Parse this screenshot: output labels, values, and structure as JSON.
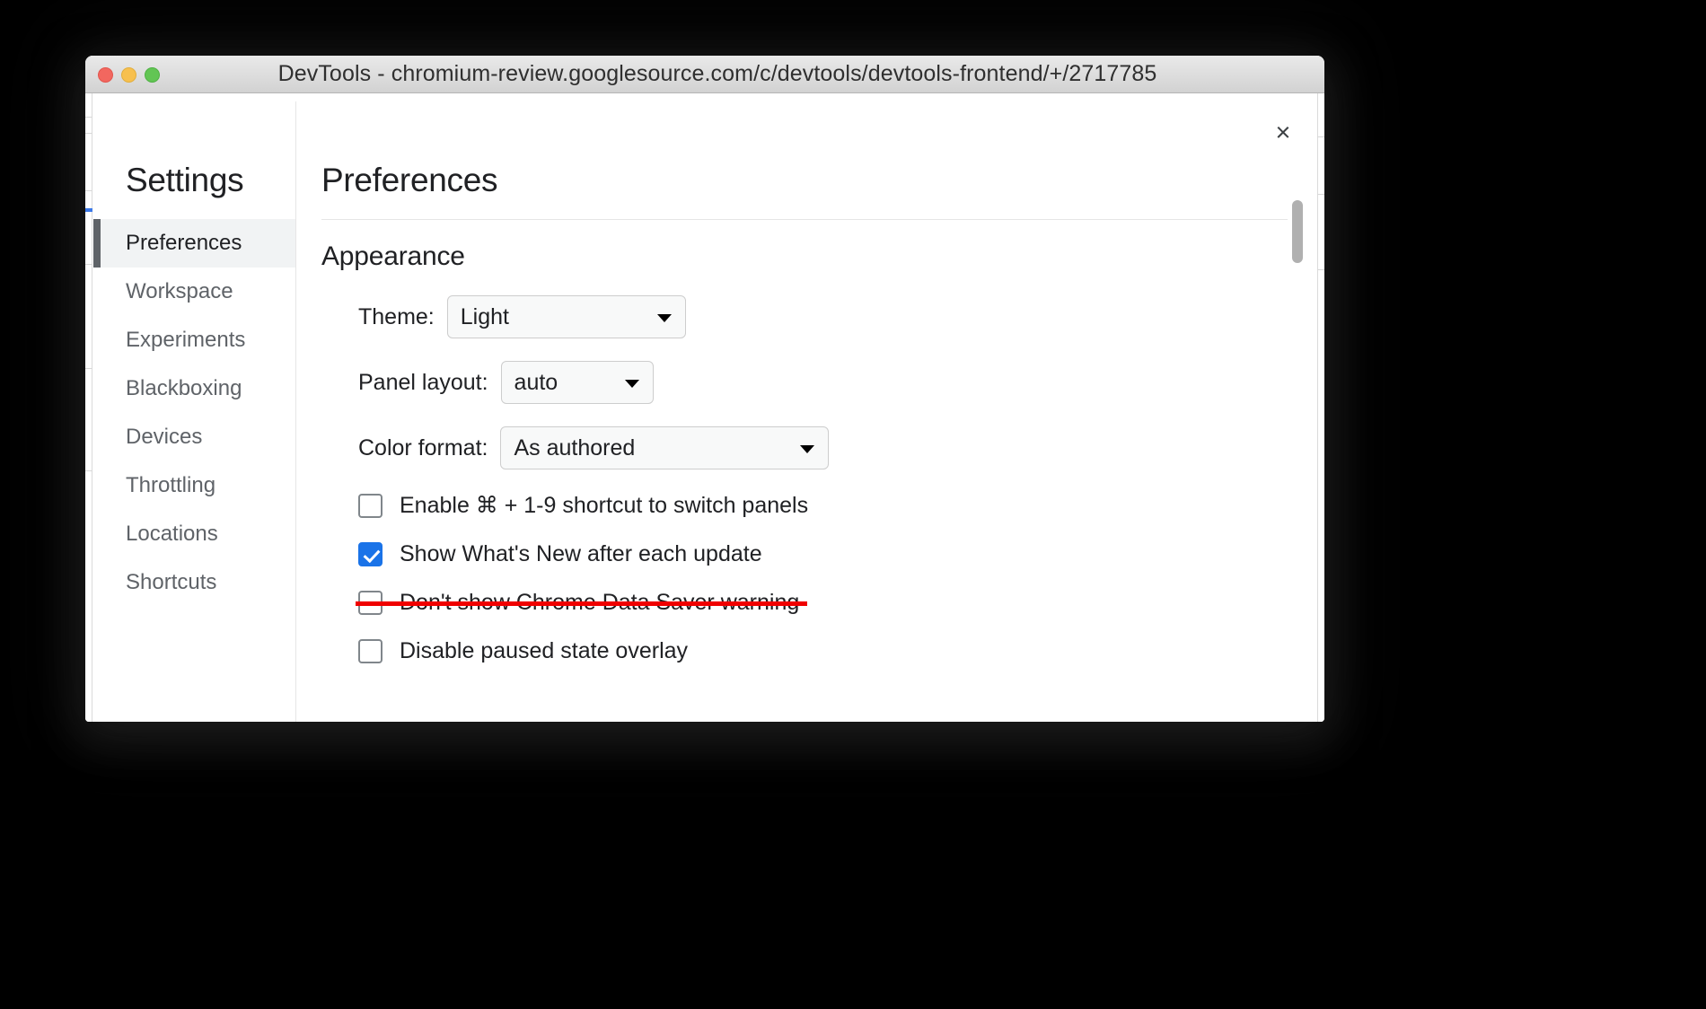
{
  "window": {
    "title": "DevTools - chromium-review.googlesource.com/c/devtools/devtools-frontend/+/2717785",
    "traffic_lights": {
      "close": "close-window",
      "minimize": "minimize-window",
      "maximize": "maximize-window"
    }
  },
  "dialog": {
    "close_label": "×",
    "sidebar": {
      "title": "Settings",
      "items": [
        {
          "label": "Preferences",
          "selected": true
        },
        {
          "label": "Workspace",
          "selected": false
        },
        {
          "label": "Experiments",
          "selected": false
        },
        {
          "label": "Blackboxing",
          "selected": false
        },
        {
          "label": "Devices",
          "selected": false
        },
        {
          "label": "Throttling",
          "selected": false
        },
        {
          "label": "Locations",
          "selected": false
        },
        {
          "label": "Shortcuts",
          "selected": false
        }
      ]
    },
    "panel": {
      "title": "Preferences",
      "section_title": "Appearance",
      "selects": [
        {
          "label": "Theme:",
          "value": "Light"
        },
        {
          "label": "Panel layout:",
          "value": "auto"
        },
        {
          "label": "Color format:",
          "value": "As authored"
        }
      ],
      "checkboxes": [
        {
          "label": "Enable ⌘ + 1-9 shortcut to switch panels",
          "checked": false,
          "struck": false
        },
        {
          "label": "Show What's New after each update",
          "checked": true,
          "struck": false
        },
        {
          "label": "Don't show Chrome Data Saver warning",
          "checked": false,
          "struck": true
        },
        {
          "label": "Disable paused state overlay",
          "checked": false,
          "struck": false
        }
      ]
    }
  },
  "colors": {
    "accent": "#1a73e8",
    "strikethrough": "#f00000",
    "selected_nav_bg": "#f1f3f4",
    "selected_nav_bar": "#5f6368",
    "traffic_close": "#f2675f",
    "traffic_min": "#f7c04f",
    "traffic_max": "#62c554"
  }
}
